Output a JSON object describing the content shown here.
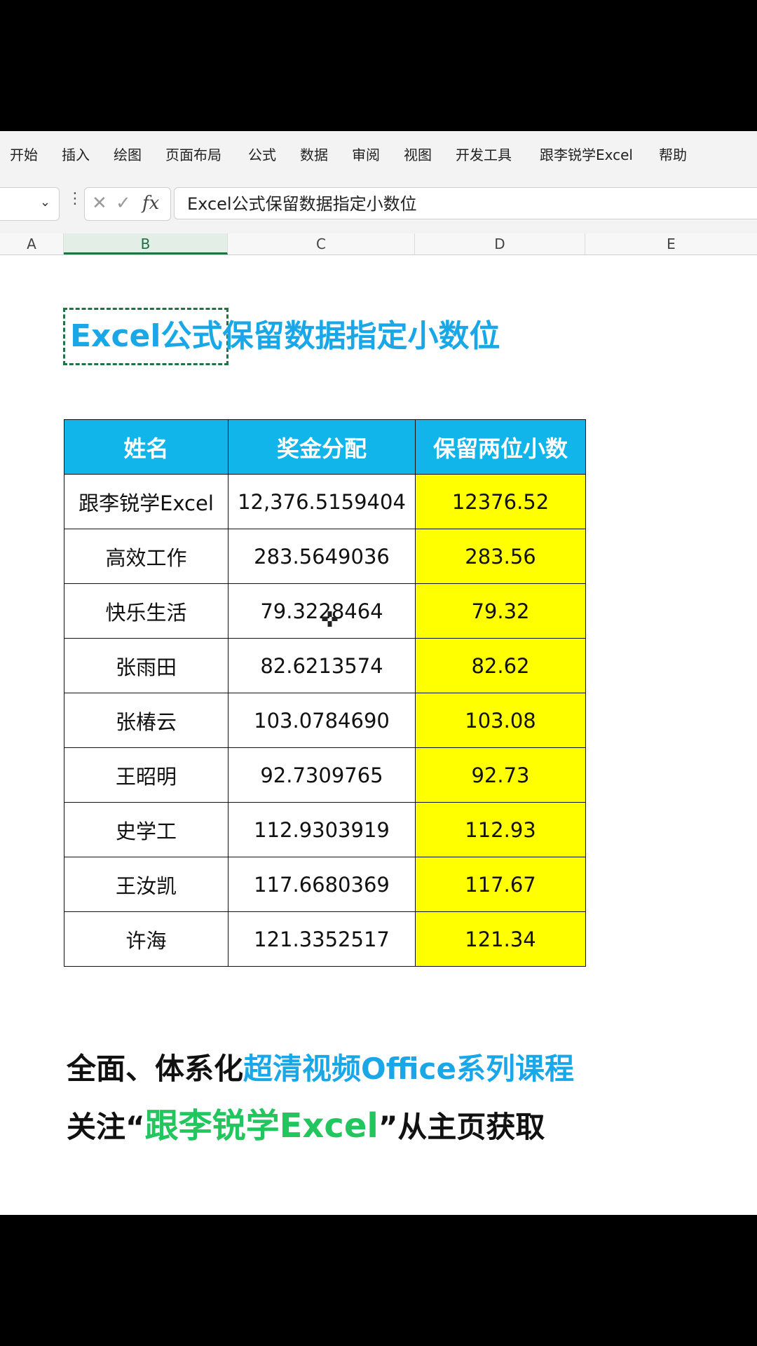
{
  "ribbon": {
    "tabs": [
      "开始",
      "插入",
      "绘图",
      "页面布局",
      "公式",
      "数据",
      "审阅",
      "视图",
      "开发工具",
      "跟李锐学Excel",
      "帮助"
    ]
  },
  "formula_bar": {
    "cancel_glyph": "✕",
    "confirm_glyph": "✓",
    "fx_label": "fx",
    "content": "Excel公式保留数据指定小数位"
  },
  "columns": [
    "A",
    "B",
    "C",
    "D",
    "E"
  ],
  "active_column": "B",
  "sheet": {
    "title": "Excel公式保留数据指定小数位",
    "table": {
      "headers": [
        "姓名",
        "奖金分配",
        "保留两位小数"
      ],
      "rows": [
        [
          "跟李锐学Excel",
          "12,376.5159404",
          "12376.52"
        ],
        [
          "高效工作",
          "283.5649036",
          "283.56"
        ],
        [
          "快乐生活",
          "79.3228464",
          "79.32"
        ],
        [
          "张雨田",
          "82.6213574",
          "82.62"
        ],
        [
          "张椿云",
          "103.0784690",
          "103.08"
        ],
        [
          "王昭明",
          "92.7309765",
          "92.73"
        ],
        [
          "史学工",
          "112.9303919",
          "112.93"
        ],
        [
          "王汝凯",
          "117.6680369",
          "117.67"
        ],
        [
          "许海",
          "121.3352517",
          "121.34"
        ]
      ]
    }
  },
  "promo": {
    "line1_dark": "全面、体系化",
    "line1_blue": "超清视频Office系列课程",
    "line2_dark_a": "关注“",
    "line2_green": "跟李锐学Excel",
    "line2_dark_b": "”从主页获取"
  },
  "colors": {
    "header_fill": "#11b5ea",
    "highlight_fill": "#ffff00",
    "title_color": "#1aa7e8",
    "accent_green": "#22c55e",
    "excel_green": "#217346"
  }
}
